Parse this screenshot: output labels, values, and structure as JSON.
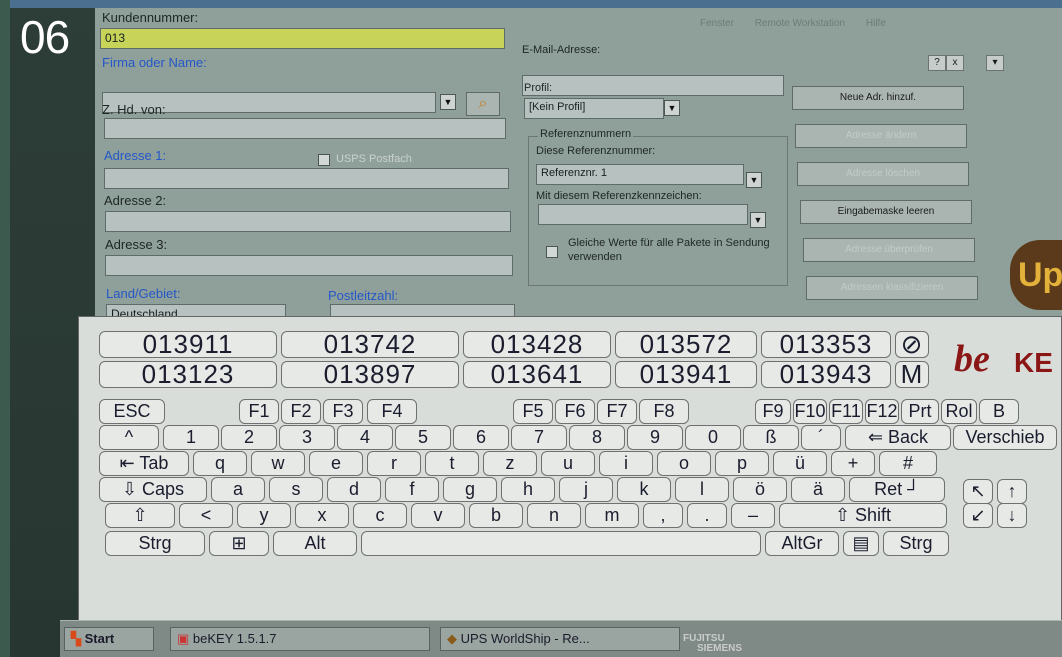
{
  "badge": "06",
  "menu": [
    "Fenster",
    "Remote Workstation",
    "Hilfe"
  ],
  "window_controls": [
    "?",
    "x",
    "▾"
  ],
  "form": {
    "kundennummer_label": "Kundennummer:",
    "kundennummer_value": "013",
    "firma_label": "Firma oder Name:",
    "zhd_label": "Z. Hd. von:",
    "adresse1_label": "Adresse 1:",
    "usps_label": "USPS Postfach",
    "adresse2_label": "Adresse 2:",
    "adresse3_label": "Adresse 3:",
    "land_label": "Land/Gebiet:",
    "land_value": "Deutschland",
    "plz_label": "Postleitzahl:",
    "email_label": "E-Mail-Adresse:",
    "profil_label": "Profil:",
    "profil_value": "[Kein Profil]",
    "ref_group_label": "Referenznummern",
    "ref_diese_label": "Diese Referenznummer:",
    "ref_diese_value": "Referenznr. 1",
    "ref_mit_label": "Mit diesem Referenzkennzeichen:",
    "gleiche_label": "Gleiche Werte für alle Pakete in Sendung verwenden"
  },
  "buttons": [
    {
      "label": "Neue Adr. hinzuf.",
      "enabled": true
    },
    {
      "label": "Adresse ändern",
      "enabled": false
    },
    {
      "label": "Adresse löschen",
      "enabled": false
    },
    {
      "label": "Eingabemaske leeren",
      "enabled": true
    },
    {
      "label": "Adresse überprüfen",
      "enabled": false
    },
    {
      "label": "Adressen klassifizieren",
      "enabled": false
    }
  ],
  "keyboard": {
    "suggestions_row1": [
      "013911",
      "013742",
      "013428",
      "013572",
      "013353",
      "⊘"
    ],
    "suggestions_row2": [
      "013123",
      "013897",
      "013641",
      "013941",
      "013943",
      "M"
    ],
    "logo_be": "be",
    "logo_key": "KE",
    "fn_row": [
      "ESC",
      "F1",
      "F2",
      "F3",
      "F4",
      "F5",
      "F6",
      "F7",
      "F8",
      "F9",
      "F10",
      "F11",
      "F12",
      "Prt",
      "Rol",
      "B"
    ],
    "num_row": [
      "^",
      "1",
      "2",
      "3",
      "4",
      "5",
      "6",
      "7",
      "8",
      "9",
      "0",
      "ß",
      "´",
      "⇐ Back",
      "Verschieb"
    ],
    "tab_row": [
      "⇤ Tab",
      "q",
      "w",
      "e",
      "r",
      "t",
      "z",
      "u",
      "i",
      "o",
      "p",
      "ü",
      "+",
      "#"
    ],
    "caps_row": [
      "⇩ Caps",
      "a",
      "s",
      "d",
      "f",
      "g",
      "h",
      "j",
      "k",
      "l",
      "ö",
      "ä",
      "Ret ┘"
    ],
    "shift_row": [
      "⇧",
      "<",
      "y",
      "x",
      "c",
      "v",
      "b",
      "n",
      "m",
      ",",
      ".",
      "–",
      "⇧ Shift"
    ],
    "bottom_row": [
      "Strg",
      "⊞",
      "Alt",
      "",
      "AltGr",
      "▤",
      "Strg"
    ],
    "arrows": [
      "↖",
      "↑",
      "↙",
      "↓"
    ]
  },
  "taskbar": {
    "start": "Start",
    "item1": "beKEY 1.5.1.7",
    "item2": "UPS WorldShip - Re..."
  },
  "monitor_brand": [
    "FUJITSU",
    "SIEMENS"
  ]
}
